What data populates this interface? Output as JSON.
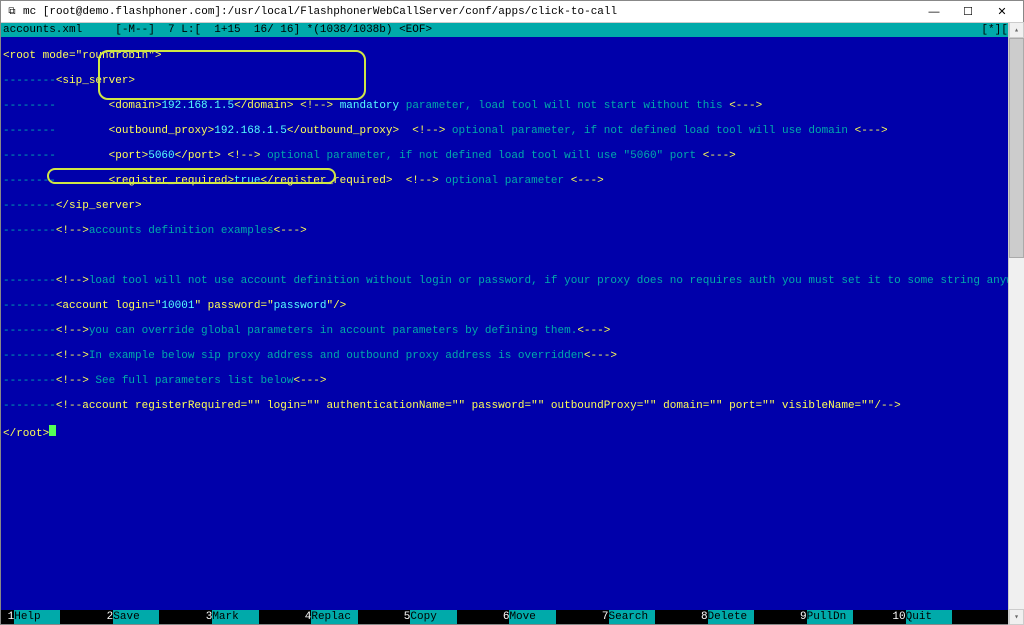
{
  "window": {
    "icon_glyph": "⧉",
    "title": "mc [root@demo.flashphoner.com]:/usr/local/FlashphonerWebCallServer/conf/apps/click-to-call",
    "minimize": "—",
    "maximize": "☐",
    "close": "✕"
  },
  "status": {
    "filename": "accounts.xml",
    "mode": "[-M--]",
    "pos": "7 L:[  1+15  16/ 16] *(1038/1038b) <EOF>",
    "right": "[*][X]"
  },
  "xml": {
    "root_open": "<root mode=\"roundrobin\">",
    "dashes8": "--------",
    "sip_open_tag": "<sip_server>",
    "domain_open": "<domain>",
    "domain_val": "192.168.1.5",
    "domain_close": "</domain>",
    "c_open": "<!-->",
    "mandatory": " mandatory",
    "param_no_start": " parameter, load tool will not start without this ",
    "c_close_dashes": "<--->",
    "outbound_open": "<outbound_proxy>",
    "outbound_val": "192.168.1.5",
    "outbound_close": "</outbound_proxy>",
    "optional_param1": " optional parameter, if not defined load tool will use domain ",
    "port_open": "<port>",
    "port_val": "5060",
    "port_close": "</port>",
    "optional_param2": " optional parameter, if not defined load tool will use \"5060\" port ",
    "reg_open": "<register_required>",
    "reg_val": "true",
    "reg_close": "</register_required>",
    "optional_param3": " optional parameter ",
    "sip_close_tag": "</sip_server>",
    "accounts_def": "accounts definition examples",
    "arrow": "<--->",
    "note1": "load tool will not use account definition without login or password, if your proxy does no requires auth you must set it to some string anyway",
    "account_open": "<account login=\"",
    "login_val": "10001",
    "account_mid": "\" password=\"",
    "pass_val": "password",
    "account_end": "\"/>",
    "note2": "you can override global parameters in account parameters by defining them.",
    "note3": "In example below sip proxy address and outbound proxy address is overridden",
    "note4": " See full parameters list below",
    "comment_acct": "<!--account registerRequired=\"\" login=\"\" authenticationName=\"\" password=\"\" outboundProxy=\"\" domain=\"\" port=\"\" visibleName=\"\"/-->",
    "root_close": "</root>"
  },
  "fnkeys": [
    {
      "n": "1",
      "label": "Help   "
    },
    {
      "n": "2",
      "label": "Save   "
    },
    {
      "n": "3",
      "label": "Mark   "
    },
    {
      "n": "4",
      "label": "Replac "
    },
    {
      "n": "5",
      "label": "Copy   "
    },
    {
      "n": "6",
      "label": "Move   "
    },
    {
      "n": "7",
      "label": "Search "
    },
    {
      "n": "8",
      "label": "Delete "
    },
    {
      "n": "9",
      "label": "PullDn "
    },
    {
      "n": "10",
      "label": "Quit   "
    }
  ]
}
